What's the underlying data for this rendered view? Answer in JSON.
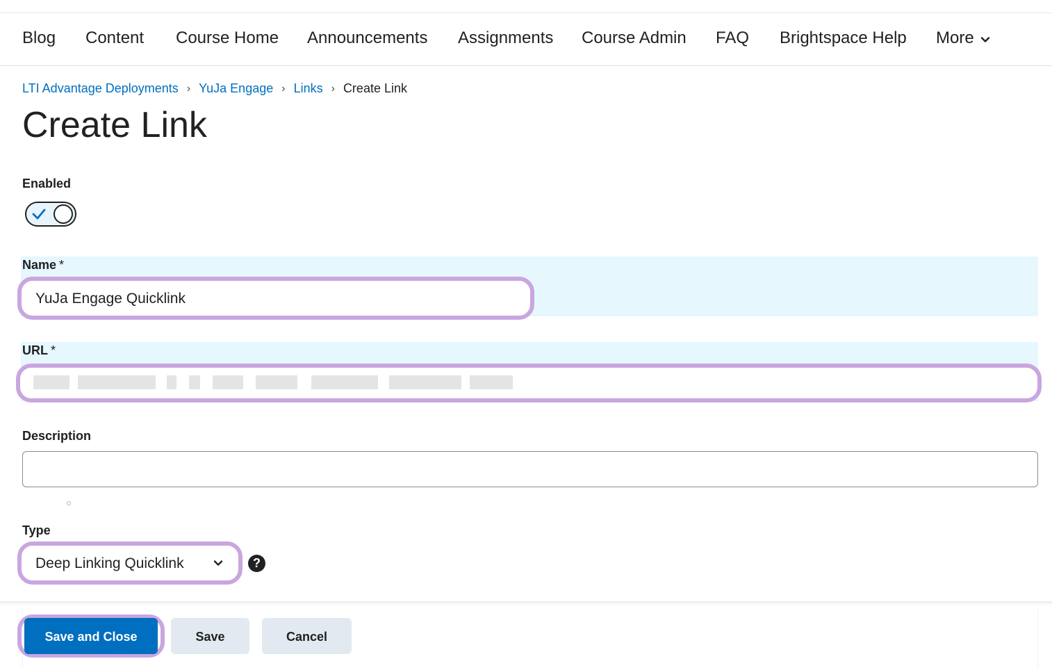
{
  "nav": {
    "items": [
      "Blog",
      "Content",
      "Course Home",
      "Announcements",
      "Assignments",
      "Course Admin",
      "FAQ",
      "Brightspace Help"
    ],
    "more_label": "More"
  },
  "breadcrumb": {
    "links": [
      "LTI Advantage Deployments",
      "YuJa Engage",
      "Links"
    ],
    "separator": "›",
    "current": "Create Link"
  },
  "page_title": "Create Link",
  "form": {
    "enabled_label": "Enabled",
    "enabled_value": true,
    "name_label": "Name",
    "name_value": "YuJa Engage Quicklink",
    "url_label": "URL",
    "required_marker": "*",
    "description_label": "Description",
    "description_value": "",
    "type_label": "Type",
    "type_value": "Deep Linking Quicklink",
    "help_glyph": "?"
  },
  "footer": {
    "save_and_close_label": "Save and Close",
    "save_label": "Save",
    "cancel_label": "Cancel"
  },
  "colors": {
    "link": "#006fbf",
    "primary_button": "#006fbf",
    "callout_highlight": "#c9a6e0",
    "field_highlight_band": "#e6f7fe"
  },
  "icons": [
    "chevron-down-icon",
    "checkmark-icon",
    "help-icon"
  ]
}
